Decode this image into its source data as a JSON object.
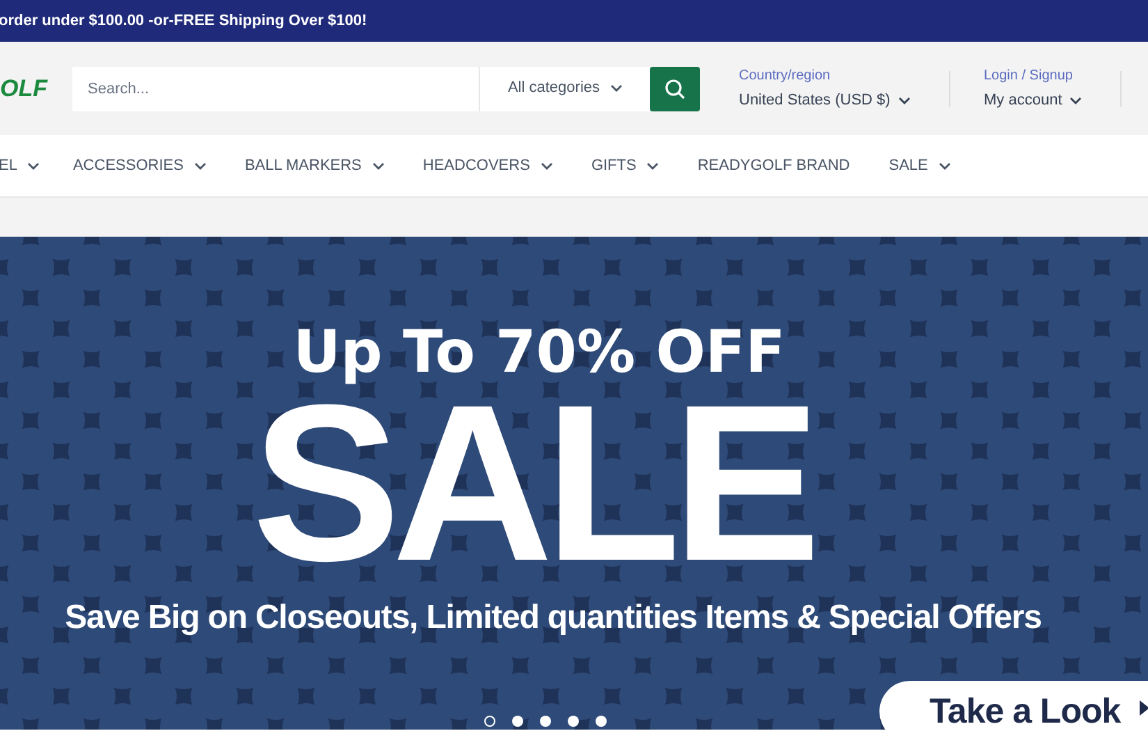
{
  "announcement": "order under $100.00 -or-FREE Shipping Over $100!",
  "header": {
    "logo": "OLF",
    "search": {
      "placeholder": "Search..."
    },
    "category_select": "All categories",
    "country": {
      "label": "Country/region",
      "value": "United States (USD $)"
    },
    "account": {
      "label": "Login / Signup",
      "value": "My account"
    }
  },
  "nav": [
    {
      "label": "EL",
      "dropdown": true
    },
    {
      "label": "ACCESSORIES",
      "dropdown": true
    },
    {
      "label": "BALL MARKERS",
      "dropdown": true
    },
    {
      "label": "HEADCOVERS",
      "dropdown": true
    },
    {
      "label": "GIFTS",
      "dropdown": true
    },
    {
      "label": "READYGOLF BRAND",
      "dropdown": false
    },
    {
      "label": "SALE",
      "dropdown": true
    }
  ],
  "banner": {
    "kind": "picture",
    "headline": "Up To 70% OFF",
    "title": "SALE",
    "subtitle": "Save Big on Closeouts, Limited quantities Items & Special Offers",
    "button": "Take a Look",
    "slides": [
      {
        "selected": true
      },
      {
        "selected": false
      },
      {
        "selected": false
      },
      {
        "selected": false
      },
      {
        "selected": false
      }
    ]
  }
}
